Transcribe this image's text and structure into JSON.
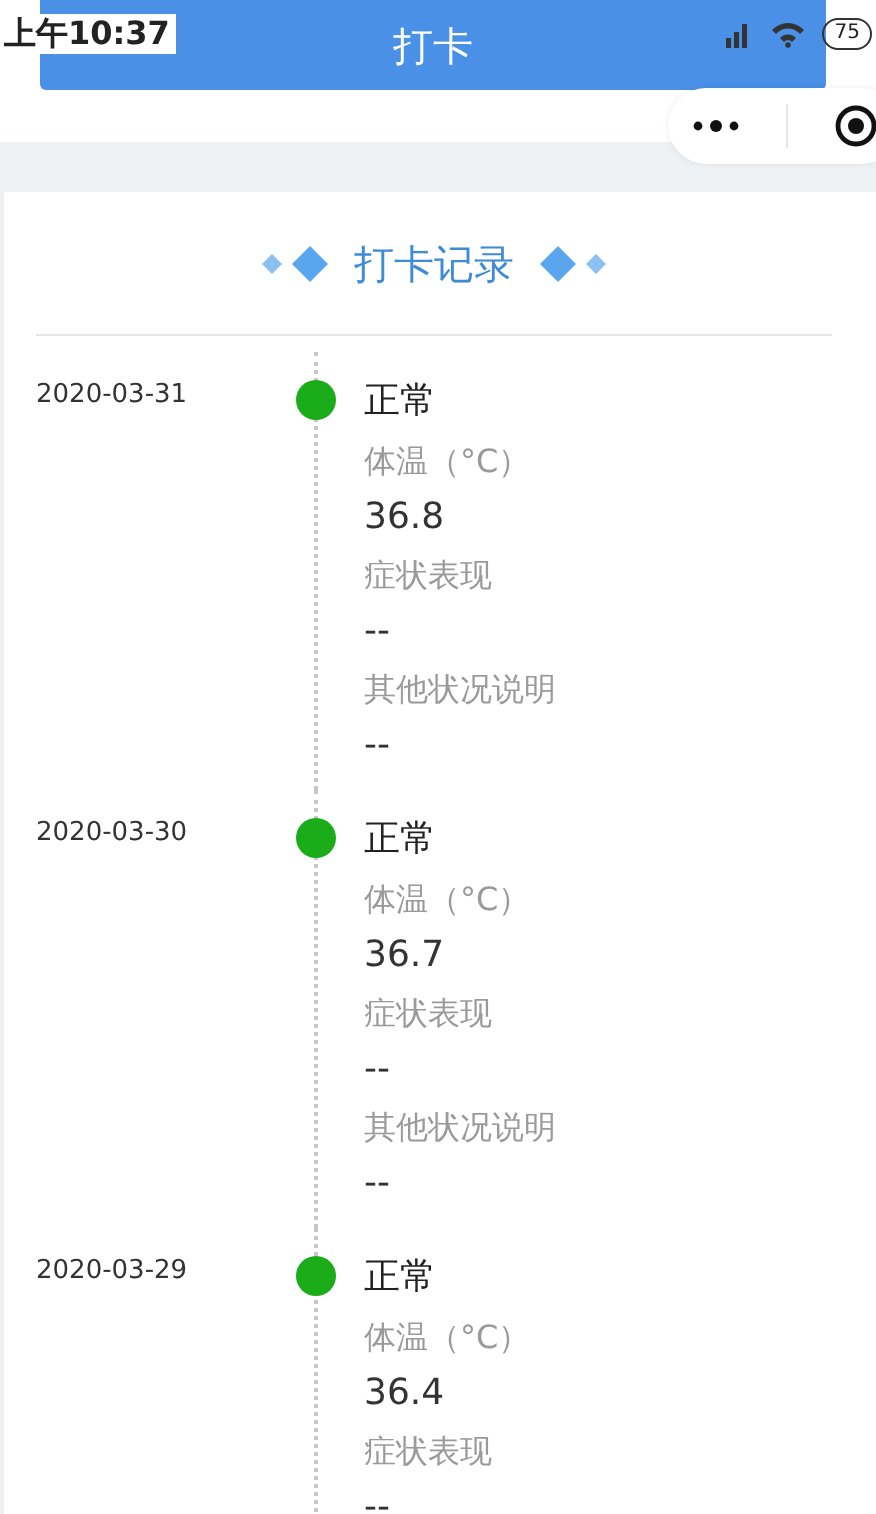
{
  "status_bar": {
    "time": "上午10:37",
    "battery": "75"
  },
  "title_bar": {
    "title": "打卡"
  },
  "section": {
    "title": "打卡记录"
  },
  "records": [
    {
      "date": "2020-03-31",
      "status": "正常",
      "fields": [
        {
          "label": "体温（°C）",
          "value": "36.8"
        },
        {
          "label": "症状表现",
          "value": "--"
        },
        {
          "label": "其他状况说明",
          "value": "--"
        }
      ]
    },
    {
      "date": "2020-03-30",
      "status": "正常",
      "fields": [
        {
          "label": "体温（°C）",
          "value": "36.7"
        },
        {
          "label": "症状表现",
          "value": "--"
        },
        {
          "label": "其他状况说明",
          "value": "--"
        }
      ]
    },
    {
      "date": "2020-03-29",
      "status": "正常",
      "fields": [
        {
          "label": "体温（°C）",
          "value": "36.4"
        },
        {
          "label": "症状表现",
          "value": "--"
        }
      ]
    }
  ]
}
